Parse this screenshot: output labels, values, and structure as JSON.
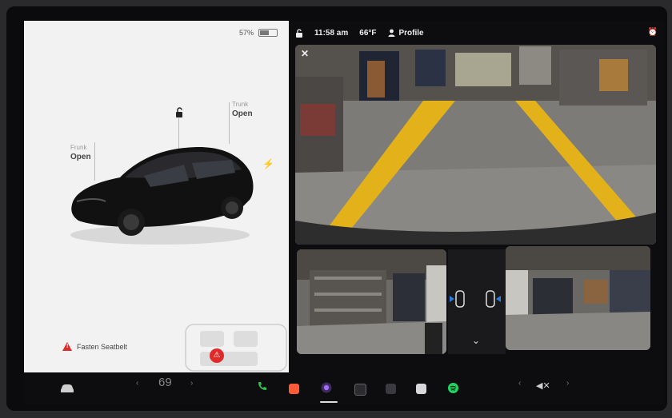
{
  "battery": {
    "percent_label": "57%",
    "level": 0.57
  },
  "car": {
    "frunk": {
      "label": "Frunk",
      "state": "Open"
    },
    "trunk": {
      "label": "Trunk",
      "state": "Open"
    },
    "icons": {
      "lock": "unlocked-padlock-icon",
      "charge": "lightning-bolt-icon"
    }
  },
  "alert": {
    "text": "Fasten Seatbelt",
    "icon": "warning-triangle-icon",
    "badge_icon": "seatbelt-icon",
    "color": "#e02a2a"
  },
  "status_bar": {
    "time": "11:58 am",
    "temperature": "66°F",
    "profile_label": "Profile"
  },
  "climate": {
    "temperature": "69"
  },
  "colors": {
    "phone": "#2fbf4a",
    "spotify": "#1ed760",
    "music": "#ff5a36",
    "camera_app": "#a36cff"
  }
}
